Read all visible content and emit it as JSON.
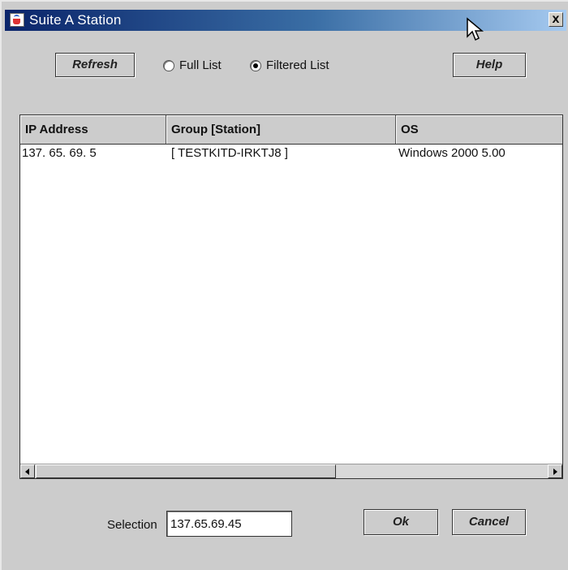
{
  "window": {
    "title": "Suite A Station",
    "close_glyph": "x"
  },
  "toolbar": {
    "refresh_label": "Refresh",
    "help_label": "Help",
    "radio_full_label": "Full List",
    "radio_filtered_label": "Filtered List",
    "selected_mode": "Filtered List"
  },
  "table": {
    "columns": [
      "IP Address",
      "Group [Station]",
      "OS"
    ],
    "rows": [
      [
        "137. 65. 69.  5",
        "[ TESTKITD-IRKTJ8 ]",
        "Windows 2000 5.00"
      ]
    ]
  },
  "selection": {
    "label": "Selection",
    "value": "137.65.69.45"
  },
  "footer": {
    "ok_label": "Ok",
    "cancel_label": "Cancel"
  },
  "icons": {
    "app": "java-cup-icon",
    "close": "close-icon",
    "cursor": "mouse-pointer-icon",
    "scroll_left": "arrow-left-icon",
    "scroll_right": "arrow-right-icon"
  },
  "colors": {
    "titlebar_start": "#0a246a",
    "titlebar_end": "#a6caf0",
    "panel": "#cccccc"
  }
}
